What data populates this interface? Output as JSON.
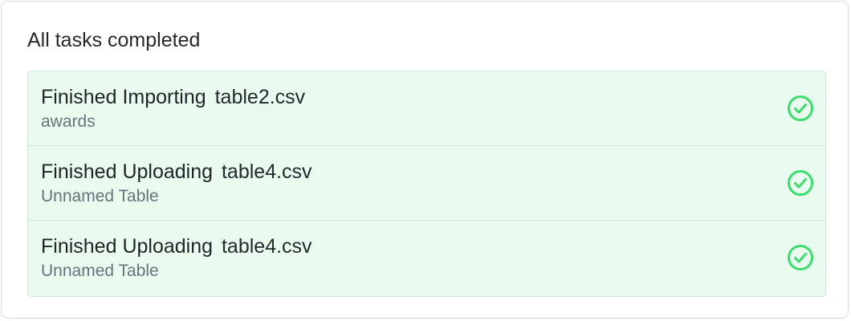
{
  "panel": {
    "title": "All tasks completed"
  },
  "tasks": [
    {
      "action": "Finished Importing",
      "file": "table2.csv",
      "subtitle": "awards",
      "status_icon": "check-circle-icon"
    },
    {
      "action": "Finished Uploading",
      "file": "table4.csv",
      "subtitle": "Unnamed Table",
      "status_icon": "check-circle-icon"
    },
    {
      "action": "Finished Uploading",
      "file": "table4.csv",
      "subtitle": "Unnamed Table",
      "status_icon": "check-circle-icon"
    }
  ],
  "colors": {
    "success_bg": "#e9fbee",
    "success_icon": "#3ddc6f",
    "title_text": "#24292e",
    "subtitle_text": "#6a737d"
  }
}
